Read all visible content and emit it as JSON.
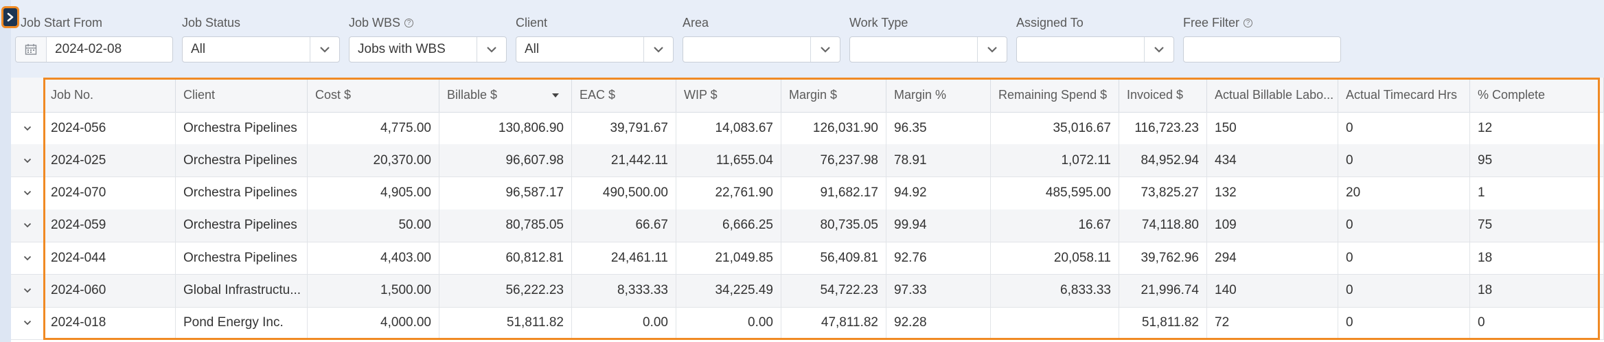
{
  "filters": {
    "job_start_from": {
      "label": "Job Start From",
      "value": "2024-02-08"
    },
    "job_status": {
      "label": "Job Status",
      "value": "All"
    },
    "job_wbs": {
      "label": "Job WBS",
      "value": "Jobs with WBS"
    },
    "client": {
      "label": "Client",
      "value": "All"
    },
    "area": {
      "label": "Area",
      "value": ""
    },
    "work_type": {
      "label": "Work Type",
      "value": ""
    },
    "assigned_to": {
      "label": "Assigned To",
      "value": ""
    },
    "free_filter": {
      "label": "Free Filter",
      "value": ""
    }
  },
  "table": {
    "columns": [
      "Job No.",
      "Client",
      "Cost $",
      "Billable $",
      "EAC $",
      "WIP $",
      "Margin $",
      "Margin %",
      "Remaining Spend $",
      "Invoiced $",
      "Actual Billable Labo...",
      "Actual Timecard Hrs",
      "% Complete"
    ],
    "sorted_column": "Billable $",
    "rows": [
      [
        "2024-056",
        "Orchestra Pipelines",
        "4,775.00",
        "130,806.90",
        "39,791.67",
        "14,083.67",
        "126,031.90",
        "96.35",
        "35,016.67",
        "116,723.23",
        "150",
        "0",
        "12"
      ],
      [
        "2024-025",
        "Orchestra Pipelines",
        "20,370.00",
        "96,607.98",
        "21,442.11",
        "11,655.04",
        "76,237.98",
        "78.91",
        "1,072.11",
        "84,952.94",
        "434",
        "0",
        "95"
      ],
      [
        "2024-070",
        "Orchestra Pipelines",
        "4,905.00",
        "96,587.17",
        "490,500.00",
        "22,761.90",
        "91,682.17",
        "94.92",
        "485,595.00",
        "73,825.27",
        "132",
        "20",
        "1"
      ],
      [
        "2024-059",
        "Orchestra Pipelines",
        "50.00",
        "80,785.05",
        "66.67",
        "6,666.25",
        "80,735.05",
        "99.94",
        "16.67",
        "74,118.80",
        "109",
        "0",
        "75"
      ],
      [
        "2024-044",
        "Orchestra Pipelines",
        "4,403.00",
        "60,812.81",
        "24,461.11",
        "21,049.85",
        "56,409.81",
        "92.76",
        "20,058.11",
        "39,762.96",
        "294",
        "0",
        "18"
      ],
      [
        "2024-060",
        "Global Infrastructu...",
        "1,500.00",
        "56,222.23",
        "8,333.33",
        "34,225.49",
        "54,722.23",
        "97.33",
        "6,833.33",
        "21,996.74",
        "140",
        "0",
        "18"
      ],
      [
        "2024-018",
        "Pond Energy Inc.",
        "4,000.00",
        "51,811.82",
        "0.00",
        "0.00",
        "47,811.82",
        "92.28",
        "",
        "51,811.82",
        "72",
        "0",
        "0"
      ]
    ]
  }
}
